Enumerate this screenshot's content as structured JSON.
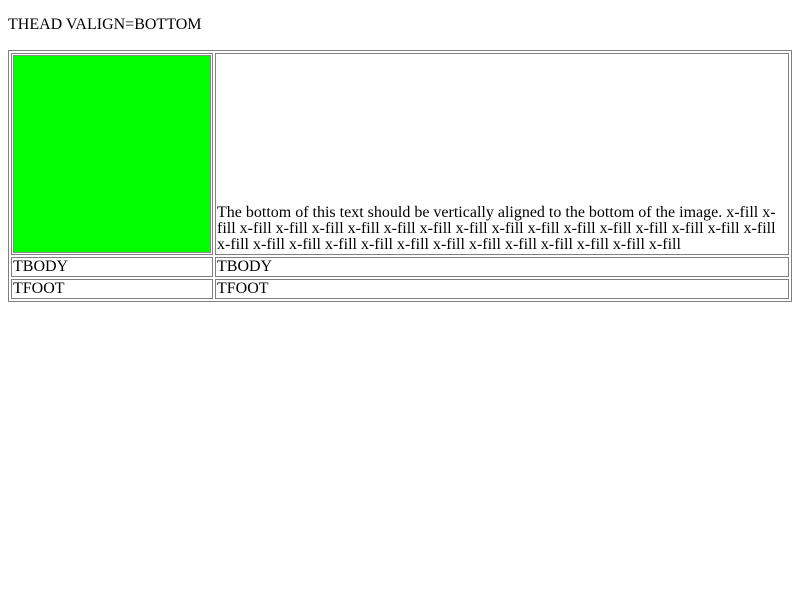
{
  "heading": "THEAD VALIGN=BOTTOM",
  "thead": {
    "image_color": "#00ff00",
    "text": "The bottom of this text should be vertically aligned to the bottom of the image. x-fill x-fill x-fill x-fill x-fill x-fill x-fill x-fill x-fill x-fill x-fill x-fill x-fill x-fill x-fill x-fill x-fill x-fill x-fill x-fill x-fill x-fill x-fill x-fill x-fill x-fill x-fill x-fill x-fill x-fill"
  },
  "tbody": {
    "cell1": "TBODY",
    "cell2": "TBODY"
  },
  "tfoot": {
    "cell1": "TFOOT",
    "cell2": "TFOOT"
  }
}
